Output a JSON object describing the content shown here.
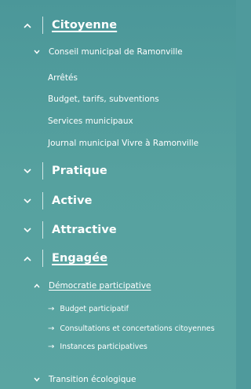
{
  "menu": {
    "citoyenne": {
      "label": "Citoyenne",
      "sub": {
        "label": "Conseil municipal de Ramonville",
        "items": [
          "Arrêtés",
          "Budget, tarifs, subventions",
          "Services municipaux",
          "Journal municipal Vivre à Ramonville"
        ]
      }
    },
    "pratique": {
      "label": "Pratique"
    },
    "active": {
      "label": "Active"
    },
    "attractive": {
      "label": "Attractive"
    },
    "engagee": {
      "label": "Engagée",
      "sub": {
        "label": "Démocratie participative",
        "items": [
          "Budget participatif",
          "Consultations et concertations citoyennes",
          "Instances participatives"
        ]
      },
      "sub2": {
        "label": "Transition écologique"
      }
    }
  },
  "icons": {
    "expanded": "chevron-up-icon",
    "collapsed": "chevron-down-icon",
    "leaf": "arrow-right-icon"
  },
  "colors": {
    "background": "#4f9a9c",
    "text": "#ffffff"
  }
}
